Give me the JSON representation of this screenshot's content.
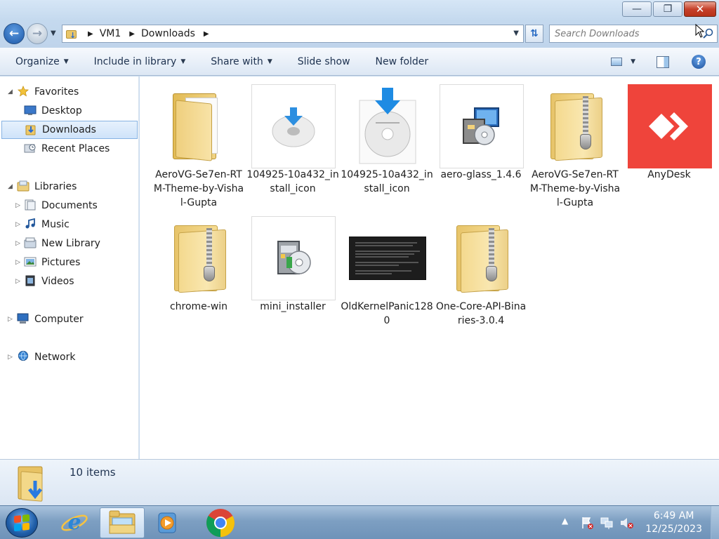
{
  "window": {
    "minimize_glyph": "—",
    "maximize_glyph": "❐",
    "close_glyph": "✕"
  },
  "address": {
    "crumbs": [
      "VM1",
      "Downloads"
    ],
    "search_placeholder": "Search Downloads"
  },
  "toolbar": {
    "organize": "Organize",
    "include_in_library": "Include in library",
    "share_with": "Share with",
    "slide_show": "Slide show",
    "new_folder": "New folder",
    "help": "?"
  },
  "nav": {
    "favorites": "Favorites",
    "desktop": "Desktop",
    "downloads": "Downloads",
    "recent_places": "Recent Places",
    "libraries": "Libraries",
    "documents": "Documents",
    "music": "Music",
    "new_library": "New Library",
    "pictures": "Pictures",
    "videos": "Videos",
    "computer": "Computer",
    "network": "Network"
  },
  "files": [
    {
      "name": "AeroVG-Se7en-RTM-Theme-by-Vishal-Gupta",
      "icon": "folder"
    },
    {
      "name": "104925-10a432_install_icon",
      "icon": "image"
    },
    {
      "name": "104925-10a432_install_icon",
      "icon": "image"
    },
    {
      "name": "aero-glass_1.4.6",
      "icon": "installer"
    },
    {
      "name": "AeroVG-Se7en-RTM-Theme-by-Vishal-Gupta",
      "icon": "zip-folder"
    },
    {
      "name": "AnyDesk",
      "icon": "anydesk"
    },
    {
      "name": "chrome-win",
      "icon": "zip-folder"
    },
    {
      "name": "mini_installer",
      "icon": "installer"
    },
    {
      "name": "OldKernelPanic1280",
      "icon": "image"
    },
    {
      "name": "One-Core-API-Binaries-3.0.4",
      "icon": "zip-folder"
    }
  ],
  "status": {
    "item_count": "10 items"
  },
  "taskbar": {
    "time": "6:49 AM",
    "date": "12/25/2023"
  },
  "colors": {
    "anydesk": "#ef443b",
    "selection": "#cfe3fa",
    "accent": "#1f5da7"
  }
}
